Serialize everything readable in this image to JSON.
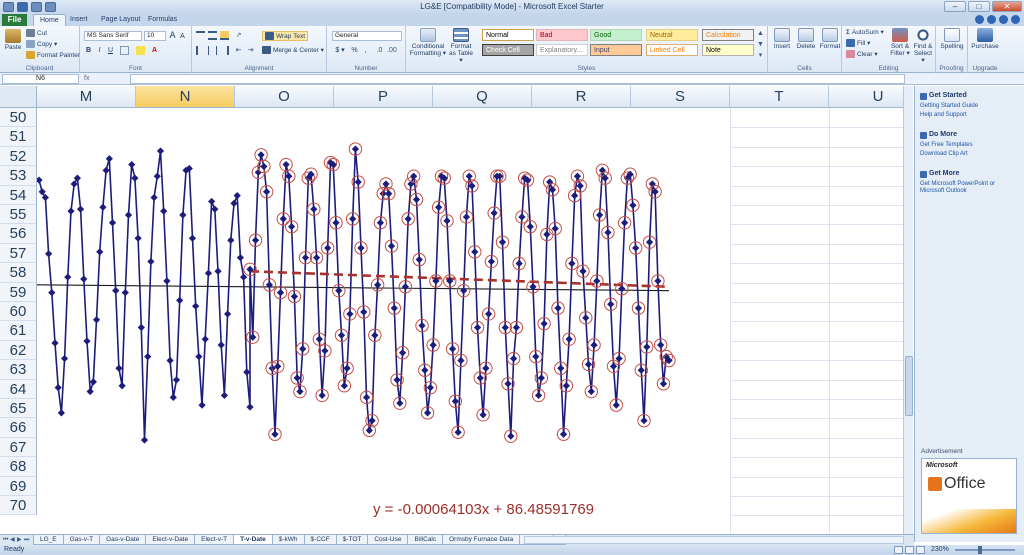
{
  "window": {
    "title": "LG&E  [Compatibility Mode] - Microsoft Excel Starter",
    "minimize": "–",
    "maximize": "□",
    "close": "✕"
  },
  "ribbon_tabs": {
    "file": "File",
    "file_key": "F",
    "items": [
      {
        "label": "Home",
        "key": "H"
      },
      {
        "label": "Insert",
        "key": "N"
      },
      {
        "label": "Page Layout",
        "key": "P"
      },
      {
        "label": "Formulas",
        "key": "M"
      }
    ]
  },
  "clipboard": {
    "paste": "Paste",
    "cut": "Cut",
    "copy": "Copy ▾",
    "format_painter": "Format Painter",
    "label": "Clipboard"
  },
  "font": {
    "name": "MS Sans Serif",
    "size": "10",
    "bold": "B",
    "italic": "I",
    "underline": "U",
    "grow": "A",
    "shrink": "A",
    "label": "Font"
  },
  "alignment": {
    "wrap_text": "Wrap Text",
    "merge_center": "Merge & Center ▾",
    "label": "Alignment"
  },
  "number": {
    "format": "General",
    "currency": "$ ▾",
    "percent": "%",
    "comma": ",",
    "label": "Number"
  },
  "styles": {
    "conditional": "Conditional Formatting ▾",
    "format_table": "Format as Table ▾",
    "cells": [
      {
        "label": "Normal",
        "bg": "#ffffff",
        "fg": "#000000",
        "border": "#c9a24a"
      },
      {
        "label": "Bad",
        "bg": "#ffc7ce",
        "fg": "#9c0006",
        "border": "#e0b4b9"
      },
      {
        "label": "Good",
        "bg": "#c6efce",
        "fg": "#006100",
        "border": "#b0d6b7"
      },
      {
        "label": "Neutral",
        "bg": "#ffeb9c",
        "fg": "#9c6500",
        "border": "#e0cf8a"
      },
      {
        "label": "Calculation",
        "bg": "#f2f2f2",
        "fg": "#fa7d00",
        "border": "#7f7f7f"
      },
      {
        "label": "Check Cell",
        "bg": "#a5a5a5",
        "fg": "#ffffff",
        "border": "#3f3f3f"
      },
      {
        "label": "Explanatory...",
        "bg": "#ffffff",
        "fg": "#7f7f7f",
        "border": "#d0d0d0"
      },
      {
        "label": "Input",
        "bg": "#ffcc99",
        "fg": "#3f3f76",
        "border": "#7f7f7f"
      },
      {
        "label": "Linked Cell",
        "bg": "#ffffff",
        "fg": "#fa7d00",
        "border": "#e0b070"
      },
      {
        "label": "Note",
        "bg": "#ffffcc",
        "fg": "#000000",
        "border": "#b2b2b2"
      }
    ],
    "label": "Styles"
  },
  "cells_group": {
    "insert": "Insert",
    "delete": "Delete",
    "format": "Format",
    "label": "Cells"
  },
  "editing": {
    "autosum": "AutoSum ▾",
    "fill": "Fill ▾",
    "clear": "Clear ▾",
    "sort_filter": "Sort & Filter ▾",
    "find_select": "Find & Select ▾",
    "label": "Editing"
  },
  "proofing": {
    "spelling": "Spelling",
    "label": "Proofing"
  },
  "upgrade": {
    "purchase": "Purchase",
    "label": "Upgrade"
  },
  "formula_bar": {
    "name_box": "N6",
    "fx": "fx",
    "value": ""
  },
  "columns": [
    "M",
    "N",
    "O",
    "P",
    "Q",
    "R",
    "S",
    "T",
    "U"
  ],
  "selected_column": "N",
  "rows": [
    "50",
    "51",
    "52",
    "53",
    "54",
    "55",
    "56",
    "57",
    "58",
    "59",
    "60",
    "61",
    "62",
    "63",
    "64",
    "65",
    "66",
    "67",
    "68",
    "69",
    "70"
  ],
  "side_pane": {
    "sections": [
      {
        "title": "Get Started",
        "links": [
          "Getting Started Guide",
          "Help and Support"
        ]
      },
      {
        "title": "Do More",
        "links": [
          "Get Free Templates",
          "Download Clip Art"
        ]
      },
      {
        "title": "Get More",
        "links": [
          "Get Microsoft PowerPoint or Microsoft Outlook"
        ]
      }
    ],
    "advertisement": "Advertisement",
    "ad_brand": "Microsoft",
    "ad_product": "Office"
  },
  "sheet_tabs": [
    "LG_E",
    "Gas-v-T",
    "Gas-v-Date",
    "Elect-v-Date",
    "Elect-v-T",
    "T-v-Date",
    "$-kWh",
    "$-CCF",
    "$-TOT",
    "Cost-Use",
    "BillCalc",
    "Ormsby Furnace Data",
    "Sheet1"
  ],
  "active_sheet": "T-v-Date",
  "status": {
    "ready": "Ready",
    "zoom": "230%"
  },
  "chart_data": {
    "type": "line",
    "title": "",
    "xlabel": "",
    "ylabel": "",
    "ylim": [
      50,
      70
    ],
    "y_reversed": true,
    "series": [
      {
        "name": "",
        "color": "#1c1c7a",
        "marker": "diamond",
        "values": [
          53.2,
          53.8,
          54.1,
          57.0,
          59.0,
          61.6,
          63.9,
          65.2,
          62.4,
          58.2,
          54.8,
          53.4,
          53.1,
          54.7,
          58.3,
          61.5,
          64.1,
          63.6,
          60.4,
          56.9,
          54.6,
          52.7,
          52.1,
          55.4,
          58.9,
          62.9,
          63.8,
          59.0,
          55.0,
          52.4,
          53.1,
          56.2,
          60.8,
          66.6,
          62.3,
          57.4,
          54.1,
          53.0,
          51.7,
          54.8,
          58.4,
          62.5,
          64.4,
          63.5,
          59.4,
          55.0,
          52.7,
          52.6,
          56.2,
          59.7,
          62.3,
          64.8,
          61.4,
          58.0,
          54.3,
          54.7,
          57.9,
          61.7,
          64.3,
          60.1,
          56.3,
          54.4,
          54.0,
          57.2,
          58.2,
          63.1,
          64.9
        ]
      },
      {
        "name": "",
        "color": "#1c1c7a",
        "marker": "diamond-circled",
        "values": [
          57.8,
          61.3,
          56.3,
          52.8,
          51.9,
          52.5,
          53.8,
          58.6,
          62.9,
          66.3,
          62.8,
          59.0,
          55.2,
          52.4,
          53.0,
          55.6,
          59.2,
          63.4,
          64.1,
          61.9,
          57.2,
          53.1,
          52.9,
          54.7,
          57.2,
          61.4,
          64.3,
          62.0,
          56.7,
          52.3,
          52.4,
          55.4,
          58.9,
          61.2,
          63.8,
          62.9,
          60.1,
          55.2,
          51.6,
          53.3,
          56.7,
          60.0,
          64.4,
          66.1,
          65.6,
          61.2,
          58.6,
          55.4,
          53.9,
          53.4,
          53.9,
          56.6,
          59.8,
          63.5,
          64.7,
          62.1,
          58.7,
          55.2,
          53.4,
          53.0,
          54.2,
          57.3,
          60.7,
          63.0,
          65.2,
          63.9,
          61.7,
          58.4,
          54.6,
          53.0,
          53.1,
          55.3,
          58.4,
          61.9,
          64.6,
          66.2,
          62.5,
          58.9,
          55.1,
          53.0,
          53.5,
          56.9,
          60.8,
          63.4,
          65.3,
          62.9,
          60.1,
          57.4,
          54.9,
          53.0,
          53.0,
          56.4,
          60.8,
          63.7,
          66.4,
          62.4,
          60.8,
          57.5,
          55.1,
          53.1,
          53.2,
          55.6,
          58.7,
          62.3,
          64.3,
          63.4,
          60.6,
          56.0,
          53.3,
          53.7,
          55.7,
          59.8,
          62.9,
          66.3,
          63.8,
          61.4,
          57.5,
          54.0,
          53.0,
          53.5,
          57.9,
          60.3,
          62.7,
          64.1,
          61.7,
          58.4,
          55.0,
          52.7,
          53.1,
          55.9,
          59.6,
          62.8,
          64.8,
          62.4,
          58.8,
          55.4,
          53.1,
          52.9,
          54.5,
          56.7,
          59.8,
          63.0,
          65.6,
          61.8,
          56.4,
          53.4,
          53.8,
          58.4,
          61.7,
          63.7,
          62.3,
          62.5
        ]
      }
    ],
    "trendlines": [
      {
        "name": "",
        "color": "#1a1a1a",
        "style": "solid",
        "y_start": 58.6,
        "y_end": 58.9
      },
      {
        "name": "",
        "color": "#a8322b",
        "style": "dashed",
        "y_start": 57.9,
        "y_end": 58.7
      }
    ],
    "annotation": "y = -0.00064103x + 86.48591769"
  }
}
